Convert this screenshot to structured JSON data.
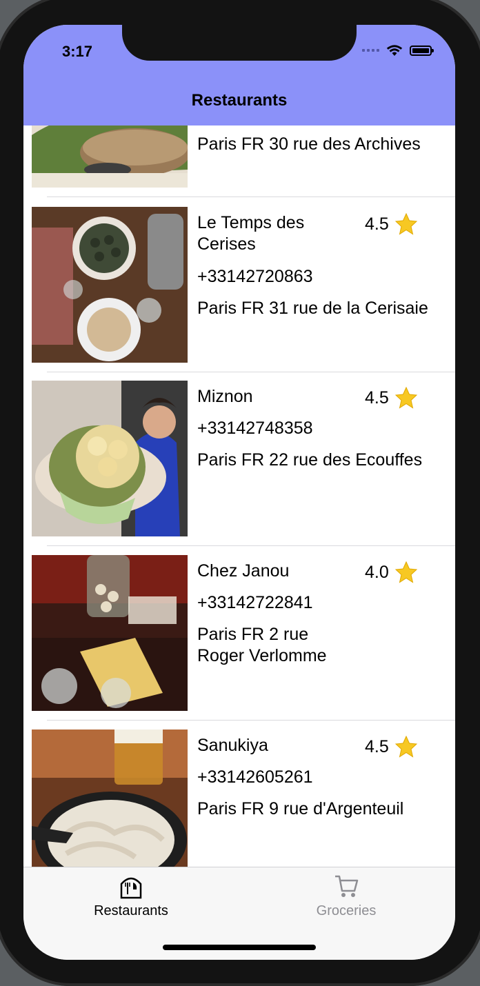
{
  "status_bar": {
    "time": "3:17"
  },
  "nav": {
    "title": "Restaurants"
  },
  "partial_row": {
    "address_partial": "Paris FR 30 rue des Archives"
  },
  "restaurants": [
    {
      "name": "Le Temps des Cerises",
      "rating": "4.5",
      "phone": "+33142720863",
      "address": "Paris FR 31 rue de la Cerisaie"
    },
    {
      "name": "Miznon",
      "rating": "4.5",
      "phone": "+33142748358",
      "address": "Paris FR 22 rue des Ecouffes"
    },
    {
      "name": "Chez Janou",
      "rating": "4.0",
      "phone": "+33142722841",
      "address": "Paris FR 2 rue Roger Verlomme"
    },
    {
      "name": "Sanukiya",
      "rating": "4.5",
      "phone": "+33142605261",
      "address": "Paris FR 9 rue d'Argenteuil"
    }
  ],
  "tabs": [
    {
      "label": "Restaurants",
      "icon": "restaurant-icon",
      "selected": true
    },
    {
      "label": "Groceries",
      "icon": "cart-icon",
      "selected": false
    }
  ],
  "colors": {
    "nav_background": "#8b91f9",
    "tab_selected": "#000000",
    "tab_unselected": "#8e8e93",
    "star": "#f7c823"
  }
}
